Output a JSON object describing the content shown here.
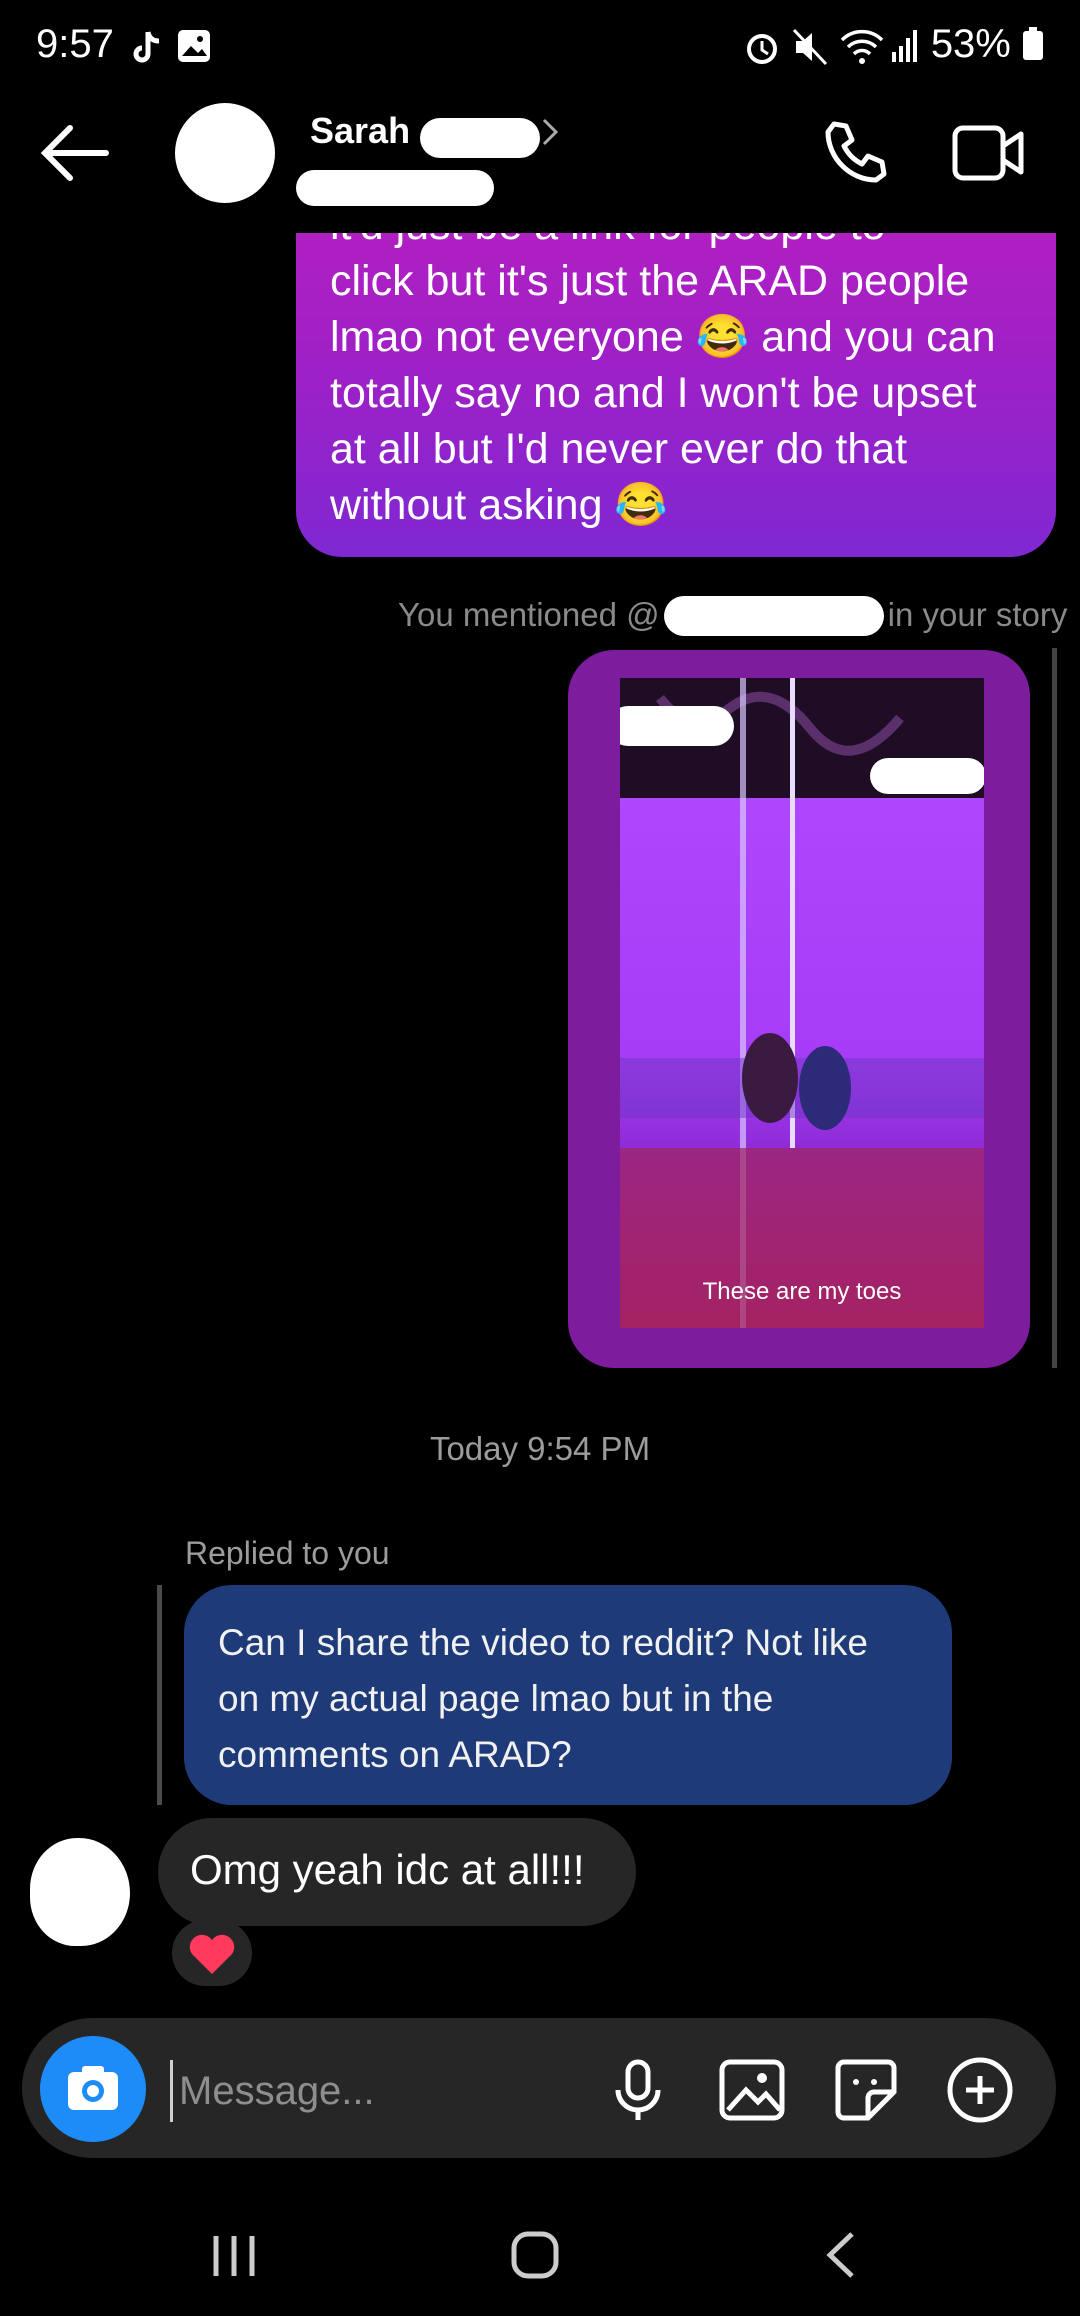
{
  "status_bar": {
    "time": "9:57",
    "battery": "53%"
  },
  "header": {
    "contact_name": "Sarah"
  },
  "messages": {
    "sent_partial": "it'd just be a link for people to",
    "sent_lines": [
      "click but it's just the ARAD people",
      "lmao not everyone 😂 and you can",
      "totally say no and I won't be upset",
      "at all but I'd never ever do that",
      "without asking 😂"
    ],
    "mention_prefix": "You mentioned @",
    "mention_suffix": "in your story",
    "story_caption": "These are my toes",
    "timestamp": "Today 9:54 PM",
    "replied_label": "Replied to you",
    "quoted": "Can I share the video to reddit? Not like on my actual page lmao but in the comments on ARAD?",
    "received": "Omg yeah idc at all!!!",
    "reaction": "❤️"
  },
  "composer": {
    "placeholder": "Message..."
  },
  "colors": {
    "sent_bubble": "#9a21c8",
    "quoted_bubble": "#1e3a78",
    "camera": "#1d8cf8"
  }
}
